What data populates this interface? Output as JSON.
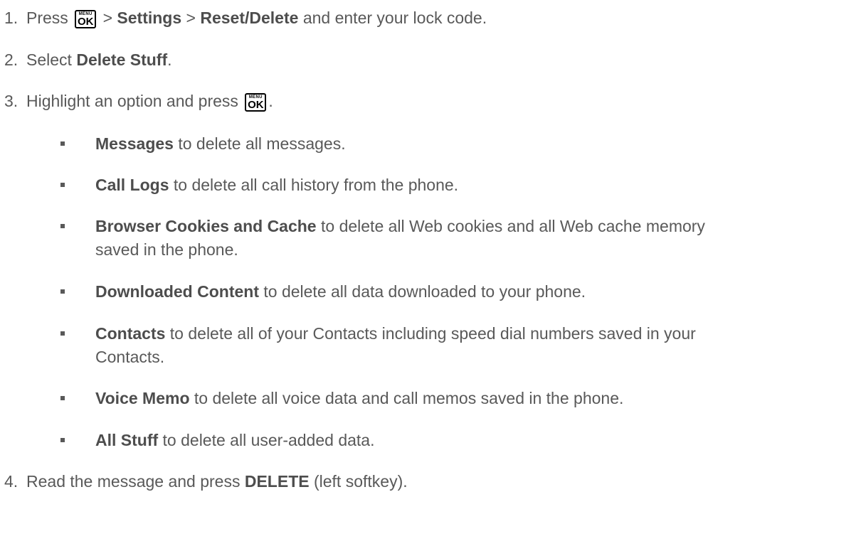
{
  "key_icon": {
    "top_label": "MENU",
    "main_label": "OK"
  },
  "steps": [
    {
      "number": "1.",
      "t1": "Press",
      "t2": ">",
      "b1": "Settings",
      "t3": ">",
      "b2": "Reset/Delete",
      "t4": "and enter your lock code."
    },
    {
      "number": "2.",
      "t1": "Select",
      "b1": "Delete Stuff",
      "t2": "."
    },
    {
      "number": "3.",
      "t1": "Highlight an option and press",
      "t2": "."
    },
    {
      "number": "4.",
      "t1": "Read the message and press",
      "b1": "DELETE",
      "t2": "(left softkey)."
    }
  ],
  "options": [
    {
      "label": "Messages",
      "text": "to delete all messages."
    },
    {
      "label": "Call Logs",
      "text": "to delete all call history from the phone."
    },
    {
      "label": "Browser Cookies and Cache",
      "text": "to delete all Web cookies and all Web cache memory",
      "continuation": "saved in the phone."
    },
    {
      "label": "Downloaded Content",
      "text": "to delete all data downloaded to your phone."
    },
    {
      "label": "Contacts",
      "text": "to delete all of your Contacts including speed dial numbers saved in your",
      "continuation": "Contacts."
    },
    {
      "label": "Voice Memo",
      "text": "to delete all voice data and call memos saved in the phone."
    },
    {
      "label": "All Stuff",
      "text": "to delete all user-added data."
    }
  ]
}
